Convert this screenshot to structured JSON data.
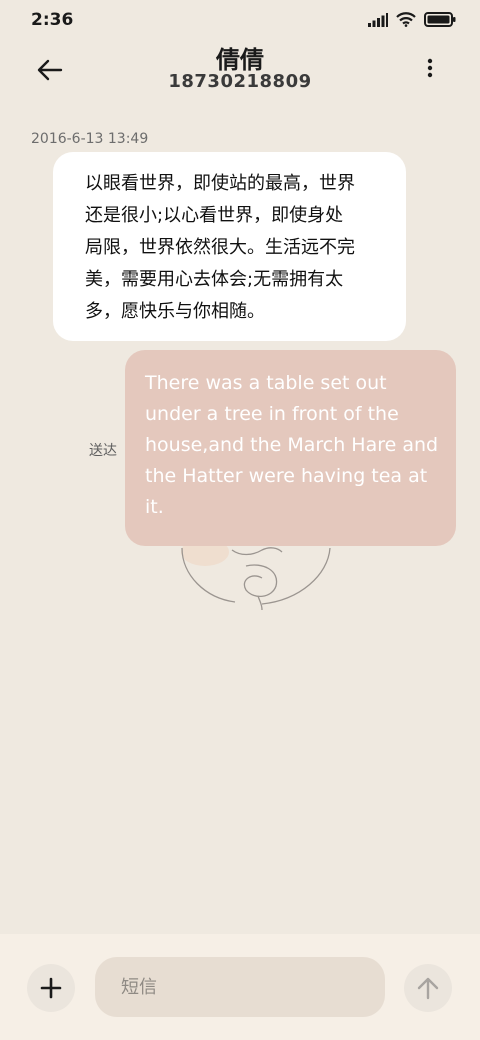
{
  "status_bar": {
    "time": "2:36",
    "icons": [
      "cellular-signal-icon",
      "wifi-icon",
      "battery-icon"
    ]
  },
  "header": {
    "contact_name": "倩倩",
    "contact_number": "18730218809",
    "back_icon": "back-arrow-icon",
    "more_icon": "more-vertical-icon"
  },
  "conversation": {
    "timestamp": "2016-6-13 13:49",
    "incoming": {
      "lines": [
        "以眼看世界，即使站的最高，世界",
        "还是很小;以心看世界，即使身处",
        "局限，世界依然很大。生活远不完",
        "美，需要用心去体会;无需拥有太",
        "多，愿快乐与你相随。"
      ]
    },
    "outgoing": {
      "status": "送达",
      "lines": [
        "There was a table set out",
        "under a tree in front of the",
        "house,and the March Hare and",
        "the Hatter were having tea at",
        "it."
      ]
    }
  },
  "composer": {
    "placeholder": "短信",
    "add_icon": "plus-icon",
    "send_icon": "arrow-up-icon"
  },
  "colors": {
    "background": "#efe9e0",
    "incoming_bubble": "#ffffff",
    "outgoing_bubble": "#e4c8bd",
    "input_bar": "#f6efe6"
  }
}
